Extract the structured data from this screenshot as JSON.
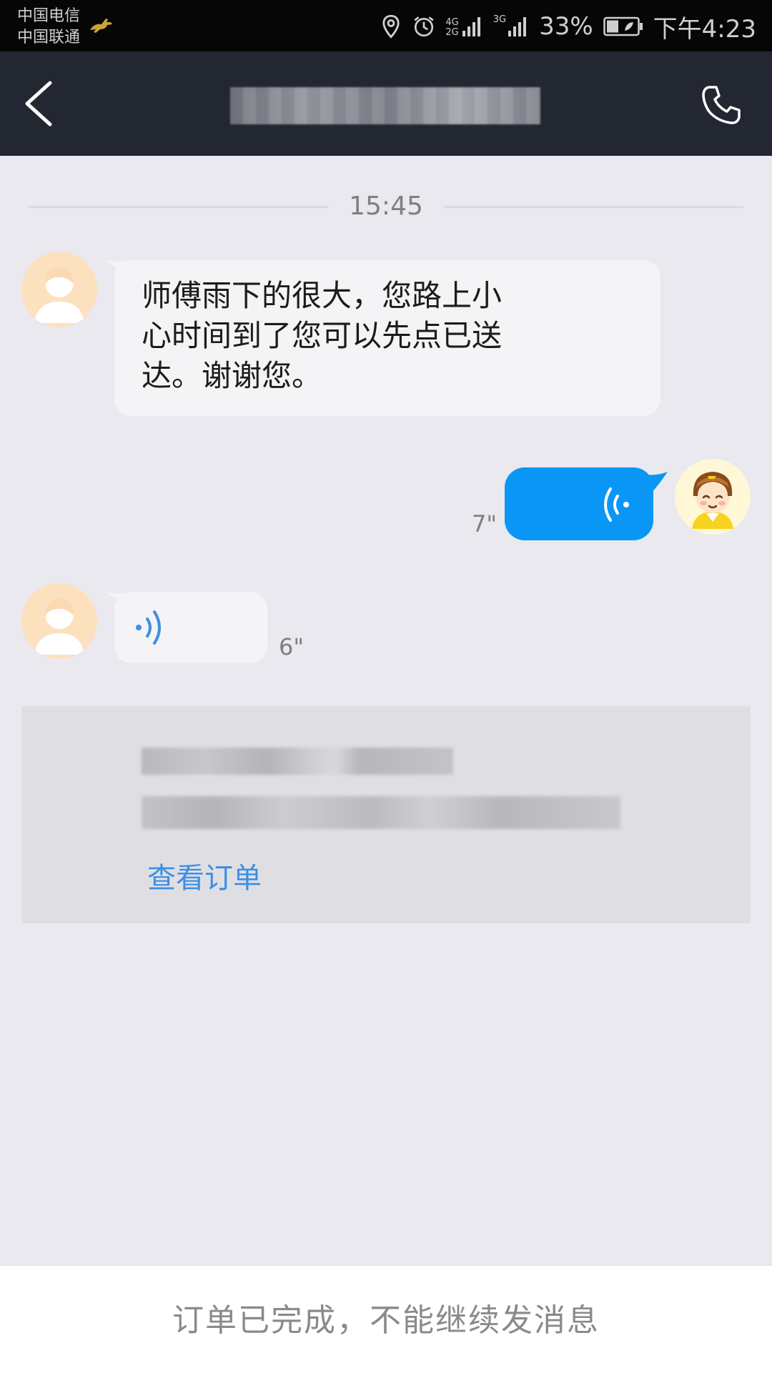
{
  "status_bar": {
    "carrier_1": "中国电信",
    "carrier_2": "中国联通",
    "network_1": "4G",
    "network_2": "2G",
    "network_3": "3G",
    "battery": "33%",
    "time": "下午4:23"
  },
  "header": {
    "title": "",
    "back_icon": "chevron-left-icon",
    "call_icon": "phone-icon"
  },
  "chat": {
    "timestamp": "15:45",
    "messages": [
      {
        "sender": "merchant",
        "type": "text",
        "text": "师傅雨下的很大，您路上小心时间到了您可以先点已送达。谢谢您。"
      },
      {
        "sender": "courier",
        "type": "voice",
        "duration": "7\""
      },
      {
        "sender": "merchant",
        "type": "voice",
        "duration": "6\""
      }
    ]
  },
  "order_card": {
    "line_1": "",
    "line_2": "",
    "link": "查看订单"
  },
  "footer": {
    "notice": "订单已完成，不能继续发消息"
  },
  "colors": {
    "header_bg": "#232732",
    "chat_bg": "#e9e9ef",
    "voice_bubble_blue": "#0a96f5",
    "link_blue": "#3d8ee6"
  }
}
